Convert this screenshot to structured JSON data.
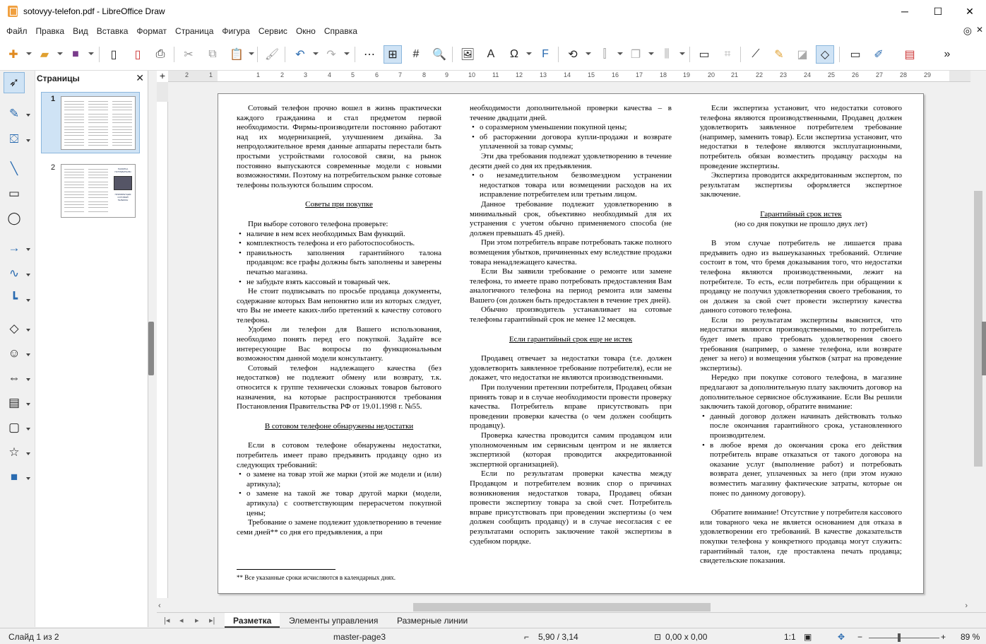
{
  "window": {
    "title": "sotovyy-telefon.pdf - LibreOffice Draw",
    "minimize": "─",
    "maximize": "☐",
    "close": "✕"
  },
  "menu": [
    "Файл",
    "Правка",
    "Вид",
    "Вставка",
    "Формат",
    "Страница",
    "Фигура",
    "Сервис",
    "Окно",
    "Справка"
  ],
  "pages_panel": {
    "title": "Страницы",
    "close": "✕",
    "page1": "1",
    "page2": "2"
  },
  "ruler": {
    "h_ticks": [
      "2",
      "1",
      "1",
      "2",
      "3",
      "4",
      "5",
      "6",
      "7",
      "8",
      "9",
      "10",
      "11",
      "12",
      "13",
      "14",
      "15",
      "16",
      "17",
      "18",
      "19",
      "20",
      "21",
      "22",
      "23",
      "24",
      "25",
      "26",
      "27",
      "28",
      "29"
    ],
    "v_ticks": [
      "1",
      "2",
      "3",
      "4",
      "5",
      "6",
      "7",
      "8",
      "9",
      "10",
      "11",
      "12",
      "13",
      "14",
      "15",
      "16",
      "17",
      "18",
      "19",
      "20"
    ]
  },
  "doc": {
    "col1": {
      "p1": "Сотовый телефон прочно вошел в жизнь практически каждого гражданина и стал предметом первой необходимости. Фирмы-производители постоянно работают над их модернизацией, улучшением дизайна. За непродолжительное время данные аппараты перестали быть простыми устройствами голосовой связи, на рынок постоянно выпускаются современные модели с новыми возможностями. Поэтому на потребительском рынке сотовые телефоны пользуются большим спросом.",
      "h1": "Советы при покупке",
      "p2": "При выборе сотового телефона проверьте:",
      "b1": "наличие в нем всех необходимых Вам функций.",
      "b2": "комплектность телефона и его работоспособность.",
      "b3": "правильность заполнения гарантийного талона продавцом: все графы должны быть заполнены и заверены печатью магазина.",
      "b4": "не забудьте взять кассовый и товарный чек.",
      "p3": "Не стоит подписывать по просьбе продавца документы, содержание которых Вам непонятно или из которых следует, что Вы не имеете каких-либо претензий к качеству сотового телефона.",
      "p4": "Удобен ли телефон для Вашего использования, необходимо понять перед его покупкой. Задайте все интересующие Вас вопросы по функциональным возможностям данной модели консультанту.",
      "p5": "Сотовый телефон надлежащего качества (без недостатков) не подлежит обмену или возврату, т.к. относится к группе технически сложных товаров бытового назначения, на которые распространяются требования Постановления Правительства РФ от 19.01.1998 г. №55.",
      "h2": "В сотовом телефоне обнаружены недостатки",
      "p6": "Если в сотовом телефоне обнаружены недостатки, потребитель имеет право предъявить продавцу одно из следующих требований:",
      "b5": "о замене на товар этой же марки (этой же модели и (или) артикула);",
      "b6": "о замене на такой же товар другой марки (модели, артикула) с соответствующим перерасчетом покупной цены;",
      "p7": "Требование о замене подлежит удовлетворению в течение семи дней** со дня его предъявления, а при"
    },
    "col2": {
      "p1": "необходимости дополнительной проверки качества – в течение двадцати дней.",
      "b1": "о соразмерном уменьшении покупной цены;",
      "b2": "об расторжении договора купли-продажи и возврате уплаченной за товар суммы;",
      "p2": "Эти два требования подлежат удовлетворению в течение десяти дней со дня их предъявления.",
      "b3": "о незамедлительном безвозмездном устранении недостатков товара или возмещении расходов на их исправление потребителем или третьим лицом.",
      "p3": "Данное требование подлежит удовлетворению в минимальный срок, объективно необходимый для их устранения с учетом обычно применяемого способа (не должен превышать 45 дней).",
      "p4": "При этом потребитель вправе потребовать также полного возмещения убытков, причиненных ему вследствие продажи товара ненадлежащего качества.",
      "p5": "Если Вы заявили требование о ремонте или замене телефона, то имеете право потребовать предоставления Вам аналогичного телефона на период ремонта или замены Вашего (он должен быть предоставлен в течение трех дней).",
      "p6": "Обычно производитель устанавливает на сотовые телефоны гарантийный срок не менее 12 месяцев.",
      "h1": "Если гарантийный срок еще не истек",
      "p7": "Продавец отвечает за недостатки товара (т.е. должен удовлетворить заявленное требование потребителя), если не докажет, что недостатки не являются производственными.",
      "p8": "При получении претензии потребителя, Продавец обязан принять товар и в случае необходимости провести проверку качества. Потребитель вправе присутствовать при проведении проверки качества (о чем должен сообщить продавцу).",
      "p9": "Проверка качества проводится самим продавцом или уполномоченным им сервисным центром и не является экспертизой (которая проводится аккредитованной экспертной организацией).",
      "p10": "Если по результатам проверки качества между Продавцом и потребителем возник спор о причинах возникновения недостатков товара, Продавец обязан провести экспертизу товара за свой счет. Потребитель вправе присутствовать при проведении экспертизы (о чем должен сообщить продавцу) и в случае несогласия с ее результатами оспорить заключение такой экспертизы в судебном порядке."
    },
    "col3": {
      "p1": "Если экспертиза установит, что недостатки сотового телефона являются производственными, Продавец должен удовлетворить заявленное потребителем требование (например, заменить товар). Если экспертиза установит, что недостатки в телефоне являются эксплуатационными, потребитель обязан возместить продавцу расходы на проведение экспертизы.",
      "p2": "Экспертиза проводится аккредитованным экспертом, по результатам экспертизы оформляется экспертное заключение.",
      "h1": "Гарантийный срок истек",
      "h1sub": "(но со дня покупки не прошло двух лет)",
      "p3": "В этом случае потребитель не лишается права предъявить одно из вышеуказанных требований. Отличие состоит в том, что бремя доказывания того, что недостатки телефона являются производственными, лежит на потребителе. То есть, если потребитель при обращении к продавцу не получил удовлетворения своего требования, то он должен за свой счет провести экспертизу качества данного сотового телефона.",
      "p4": "Если по результатам экспертизы выяснится, что недостатки являются производственными, то потребитель будет иметь право требовать удовлетворения своего требования (например, о замене телефона, или возврате денег за него) и возмещения убытков (затрат на проведение экспертизы).",
      "p5": "Нередко при покупке сотового телефона, в магазине предлагают за дополнительную плату заключить договор на дополнительное сервисное обслуживание. Если Вы решили заключить такой договор, обратите внимание:",
      "b1": "данный договор должен начинать действовать только после окончания гарантийного срока, установленного производителем.",
      "b2": "в любое время до окончания срока его действия потребитель вправе отказаться от такого договора на оказание услуг (выполнение работ) и потребовать возврата денег, уплаченных за него (при этом нужно возместить магазину фактические затраты, которые он понес по данному договору).",
      "p6": "Обратите внимание! Отсутствие у потребителя кассового или товарного чека не является основанием для отказа в удовлетворении его требований. В качестве доказательств покупки телефона у конкретного продавца могут служить: гарантийный талон, где проставлена печать продавца; свидетельские показания."
    },
    "footnote": "** Все указанные сроки исчисляются в календарных днях."
  },
  "thumb2_text": [
    "ПАМЯТКА",
    "ПОТРЕБИТЕЛЮ",
    "ПРИОБРЕТАЕМ",
    "СОТОВЫЙ",
    "ТЕЛЕФОН"
  ],
  "tabs": [
    "Разметка",
    "Элементы управления",
    "Размерные линии"
  ],
  "status": {
    "slide": "Слайд 1 из 2",
    "master": "master-page3",
    "pos": "5,90 / 3,14",
    "size": "0,00 x 0,00",
    "scale": "1:1",
    "zoom": "89 %"
  }
}
